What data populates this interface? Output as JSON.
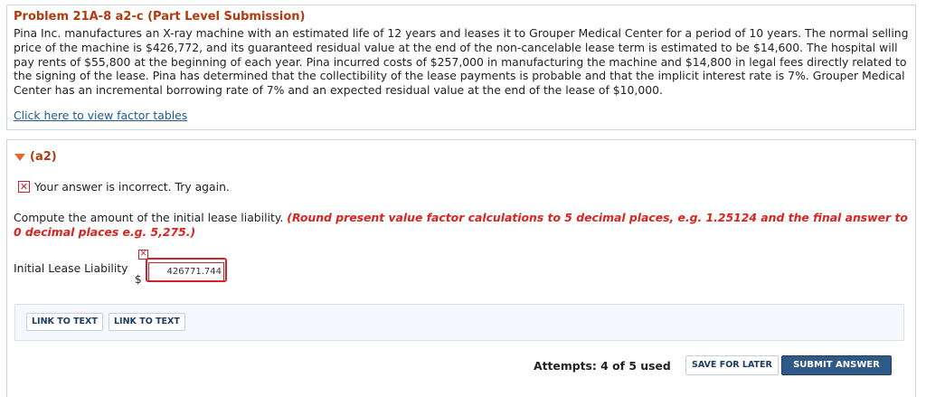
{
  "problem": {
    "title": "Problem 21A-8 a2-c (Part Level Submission)",
    "text": "Pina Inc. manufactures an X-ray machine with an estimated life of 12 years and leases it to Grouper Medical Center for a period of 10 years. The normal selling price of the machine is $426,772, and its guaranteed residual value at the end of the non-cancelable lease term is estimated to be $14,600. The hospital will pay rents of $55,800 at the beginning of each year. Pina incurred costs of $257,000 in manufacturing the machine and $14,800 in legal fees directly related to the signing of the lease. Pina has determined that the collectibility of the lease payments is probable and that the implicit interest rate is 7%. Grouper Medical Center has an incremental borrowing rate of 7% and an expected residual value at the end of the lease of $10,000.",
    "factor_link": "Click here to view factor tables"
  },
  "section": {
    "label": "(a2)",
    "feedback": "Your answer is incorrect.  Try again.",
    "instruction": "Compute the amount of the initial lease liability.",
    "hint": "(Round present value factor calculations to 5 decimal places, e.g. 1.25124 and the final answer to 0 decimal places e.g. 5,275.)",
    "field_label": "Initial Lease Liability",
    "currency": "$",
    "input_value": "426771.744",
    "links": [
      "LINK TO TEXT",
      "LINK TO TEXT"
    ]
  },
  "footer": {
    "attempts": "Attempts: 4 of 5 used",
    "save_label": "SAVE FOR LATER",
    "submit_label": "SUBMIT ANSWER"
  },
  "icons": {
    "toggle": "triangle-down-icon",
    "error": "x-mark-icon"
  },
  "colors": {
    "title": "#b33a0e",
    "error": "#d0232a",
    "link": "#1f5a96",
    "submit_bg": "#2f5a88"
  }
}
